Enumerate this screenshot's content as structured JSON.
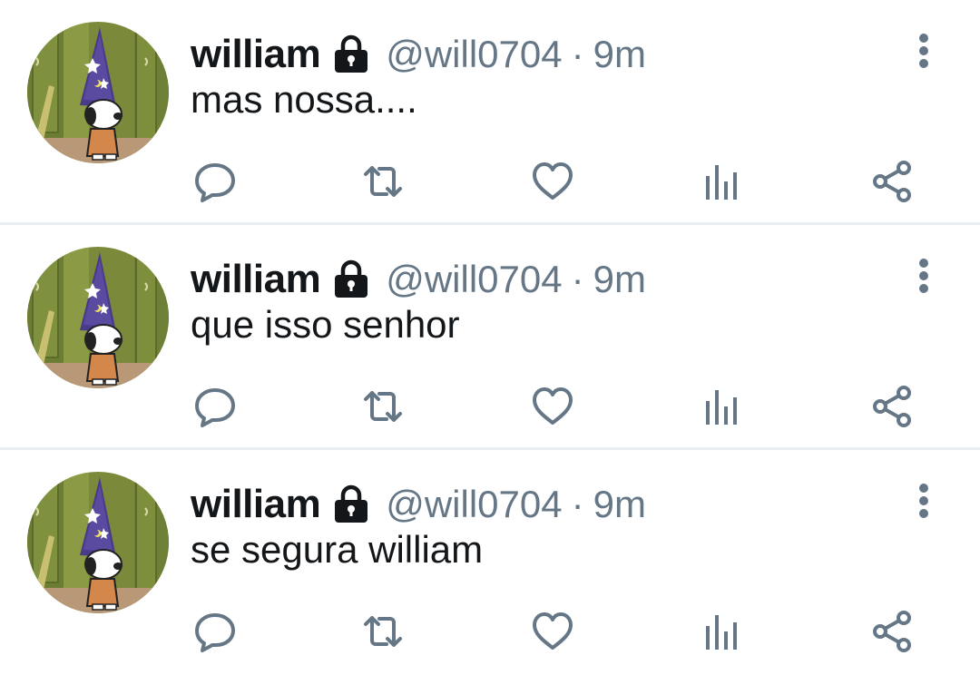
{
  "colors": {
    "name": "#14171a",
    "secondary": "#657786",
    "icon": "#657786",
    "divider": "#ebeef0"
  },
  "tweets": [
    {
      "name": "william",
      "handle": "@will0704",
      "separator": "·",
      "time": "9m",
      "text": "mas nossa....",
      "badge_icon": "lock-icon",
      "actions": [
        "reply-icon",
        "retweet-icon",
        "like-icon",
        "stats-icon",
        "share-icon"
      ]
    },
    {
      "name": "william",
      "handle": "@will0704",
      "separator": "·",
      "time": "9m",
      "text": "que isso senhor",
      "badge_icon": "lock-icon",
      "actions": [
        "reply-icon",
        "retweet-icon",
        "like-icon",
        "stats-icon",
        "share-icon"
      ]
    },
    {
      "name": "william",
      "handle": "@will0704",
      "separator": "·",
      "time": "9m",
      "text": "se segura william",
      "badge_icon": "lock-icon",
      "actions": [
        "reply-icon",
        "retweet-icon",
        "like-icon",
        "stats-icon",
        "share-icon"
      ]
    }
  ]
}
